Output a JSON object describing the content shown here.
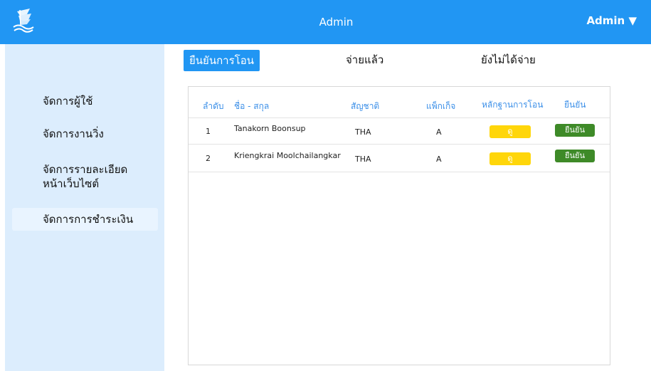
{
  "header": {
    "title": "Admin",
    "user_menu": "Admin ▼"
  },
  "sidebar": {
    "items": [
      {
        "label": "จัดการผู้ใช้"
      },
      {
        "label": "จัดการงานวิ่ง"
      },
      {
        "label": "จัดการรายละเอียด\nหน้าเว็บไซต์"
      },
      {
        "label": "จัดการการชำระเงิน"
      }
    ]
  },
  "tabs": [
    {
      "label": "ยืนยันการโอน"
    },
    {
      "label": "จ่ายแล้ว"
    },
    {
      "label": "ยังไม่ได้จ่าย"
    }
  ],
  "table": {
    "headers": [
      "ลำดับ",
      "ชื่อ - สกุล",
      "สัญชาติ",
      "แพ็กเก็จ",
      "หลักฐานการโอน",
      "ยืนยัน"
    ],
    "rows": [
      {
        "no": "1",
        "name": "Tanakorn Boonsup",
        "nationality": "THA",
        "package": "A",
        "view_label": "ดู",
        "confirm_label": "ยืนยัน"
      },
      {
        "no": "2",
        "name": "Kriengkrai Moolchailangkar",
        "nationality": "THA",
        "package": "A",
        "view_label": "ดู",
        "confirm_label": "ยืนยัน"
      }
    ]
  },
  "colors": {
    "primary": "#2196f3",
    "sidebar_bg": "#dcedfd",
    "view_button": "#ffd60a",
    "confirm_button": "#3e8a28",
    "header_text": "#3b8fe8"
  }
}
